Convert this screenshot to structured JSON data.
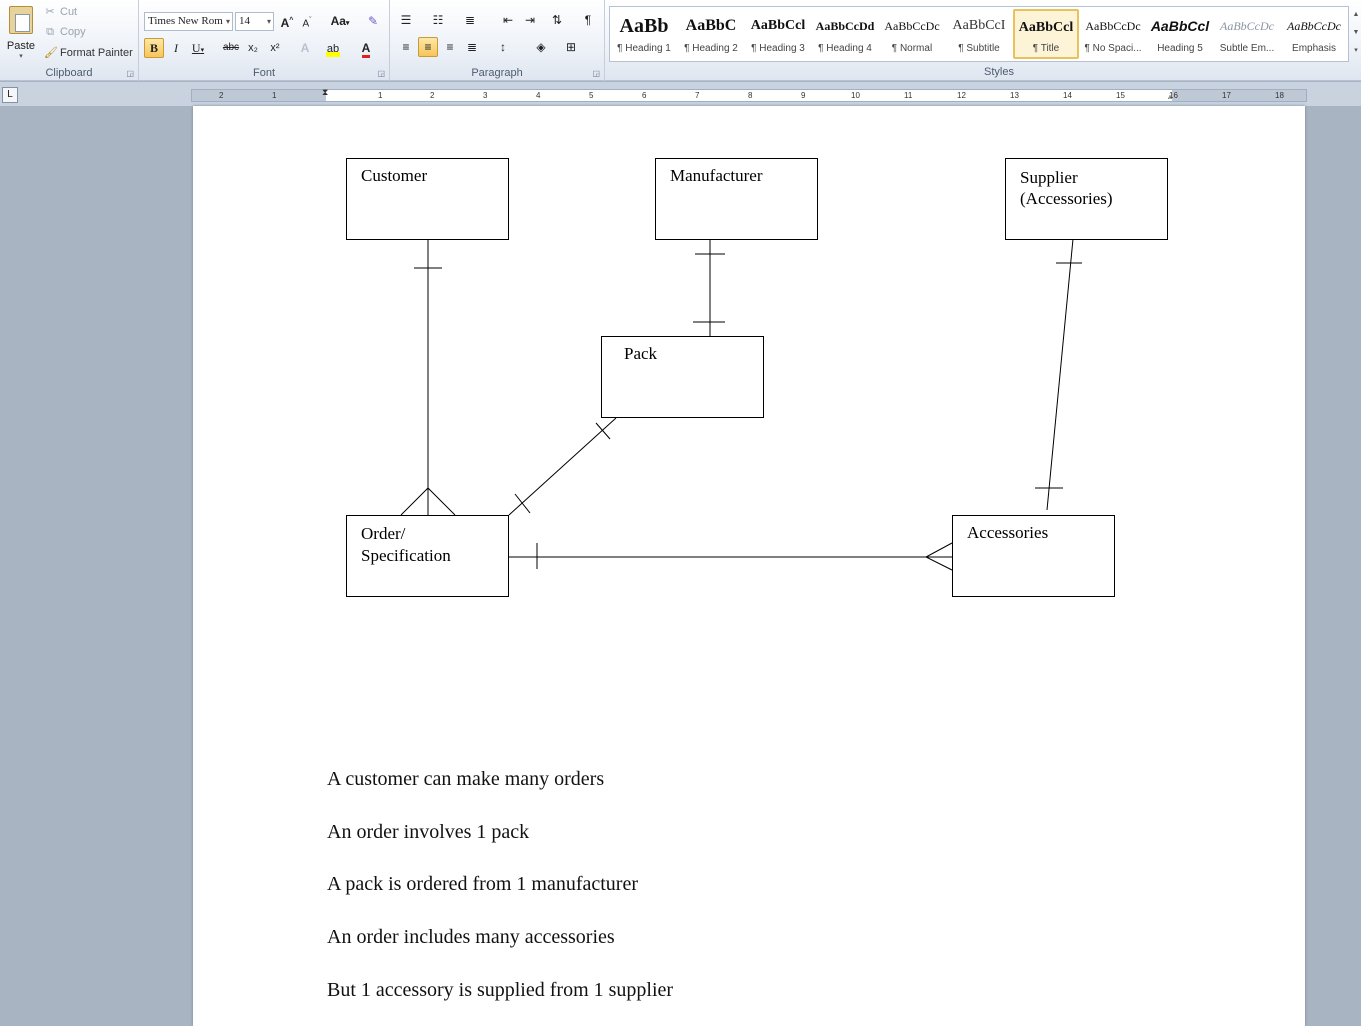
{
  "ribbon": {
    "clipboard": {
      "paste": "Paste",
      "cut": "Cut",
      "copy": "Copy",
      "format_painter": "Format Painter",
      "label": "Clipboard"
    },
    "font": {
      "family": "Times New Rom",
      "size": "14",
      "label": "Font",
      "bold": "B",
      "italic": "I",
      "underline": "U",
      "strike": "abc",
      "subscript": "x₂",
      "superscript": "x²",
      "grow": "A",
      "shrink": "A",
      "change_case": "Aa",
      "font_color_letter": "A"
    },
    "paragraph": {
      "label": "Paragraph",
      "show_marks": "¶"
    },
    "styles": {
      "label": "Styles",
      "items": [
        {
          "sample": "AaBb",
          "name": "¶ Heading 1"
        },
        {
          "sample": "AaBbC",
          "name": "¶ Heading 2"
        },
        {
          "sample": "AaBbCcl",
          "name": "¶ Heading 3"
        },
        {
          "sample": "AaBbCcDd",
          "name": "¶ Heading 4"
        },
        {
          "sample": "AaBbCcDc",
          "name": "¶ Normal"
        },
        {
          "sample": "AaBbCcI",
          "name": "¶ Subtitle"
        },
        {
          "sample": "AaBbCcl",
          "name": "¶ Title"
        },
        {
          "sample": "AaBbCcDc",
          "name": "¶ No Spaci..."
        },
        {
          "sample": "AaBbCcl",
          "name": "Heading 5"
        },
        {
          "sample": "AaBbCcDc",
          "name": "Subtle Em..."
        },
        {
          "sample": "AaBbCcDc",
          "name": "Emphasis"
        }
      ],
      "selected": "¶ Title"
    }
  },
  "ruler": {
    "numbers": [
      "2",
      "1",
      "1",
      "2",
      "3",
      "4",
      "5",
      "6",
      "7",
      "8",
      "9",
      "10",
      "11",
      "12",
      "13",
      "14",
      "15",
      "16",
      "17",
      "18"
    ],
    "tab_selector": "L"
  },
  "diagram": {
    "entities": {
      "customer": "Customer",
      "manufacturer": "Manufacturer",
      "supplier": "Supplier\n(Accessories)",
      "pack": "Pack",
      "order": "Order/\nSpecification",
      "accessories": "Accessories"
    }
  },
  "document": {
    "paragraphs": [
      "A customer can make many orders",
      "An order involves 1 pack",
      "A pack is ordered from 1 manufacturer",
      "An order includes many accessories",
      "But 1 accessory is supplied from 1 supplier"
    ]
  }
}
